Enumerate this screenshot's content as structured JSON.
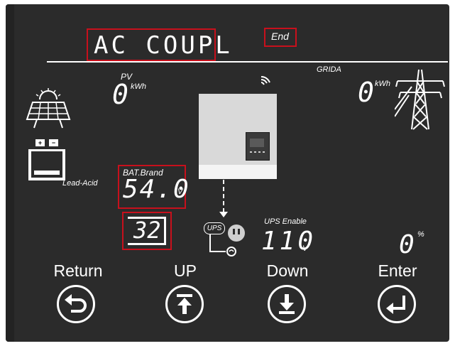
{
  "mode": {
    "text": "AC COUPL"
  },
  "end_label": "End",
  "pv": {
    "label": "PV",
    "value": "0",
    "unit": "kWh"
  },
  "grid": {
    "label": "GRIDA",
    "value": "0",
    "unit": "kWh"
  },
  "battery": {
    "brand_label": "BAT.Brand",
    "type": "Lead-Acid",
    "voltage": "54.0",
    "voltage_unit": "V",
    "icon_plus": "+",
    "icon_minus": "−"
  },
  "setting_number": {
    "value": "32"
  },
  "ups": {
    "label": "UPS",
    "enable_label": "UPS Enable",
    "voltage": "110",
    "voltage_unit": "V"
  },
  "load": {
    "value": "0",
    "unit": "%"
  },
  "buttons": {
    "return": {
      "label": "Return"
    },
    "up": {
      "label": "UP"
    },
    "down": {
      "label": "Down"
    },
    "enter": {
      "label": "Enter"
    }
  },
  "colors": {
    "panel": "#2b2b2b",
    "highlight": "#c8101c",
    "text": "#ffffff"
  }
}
